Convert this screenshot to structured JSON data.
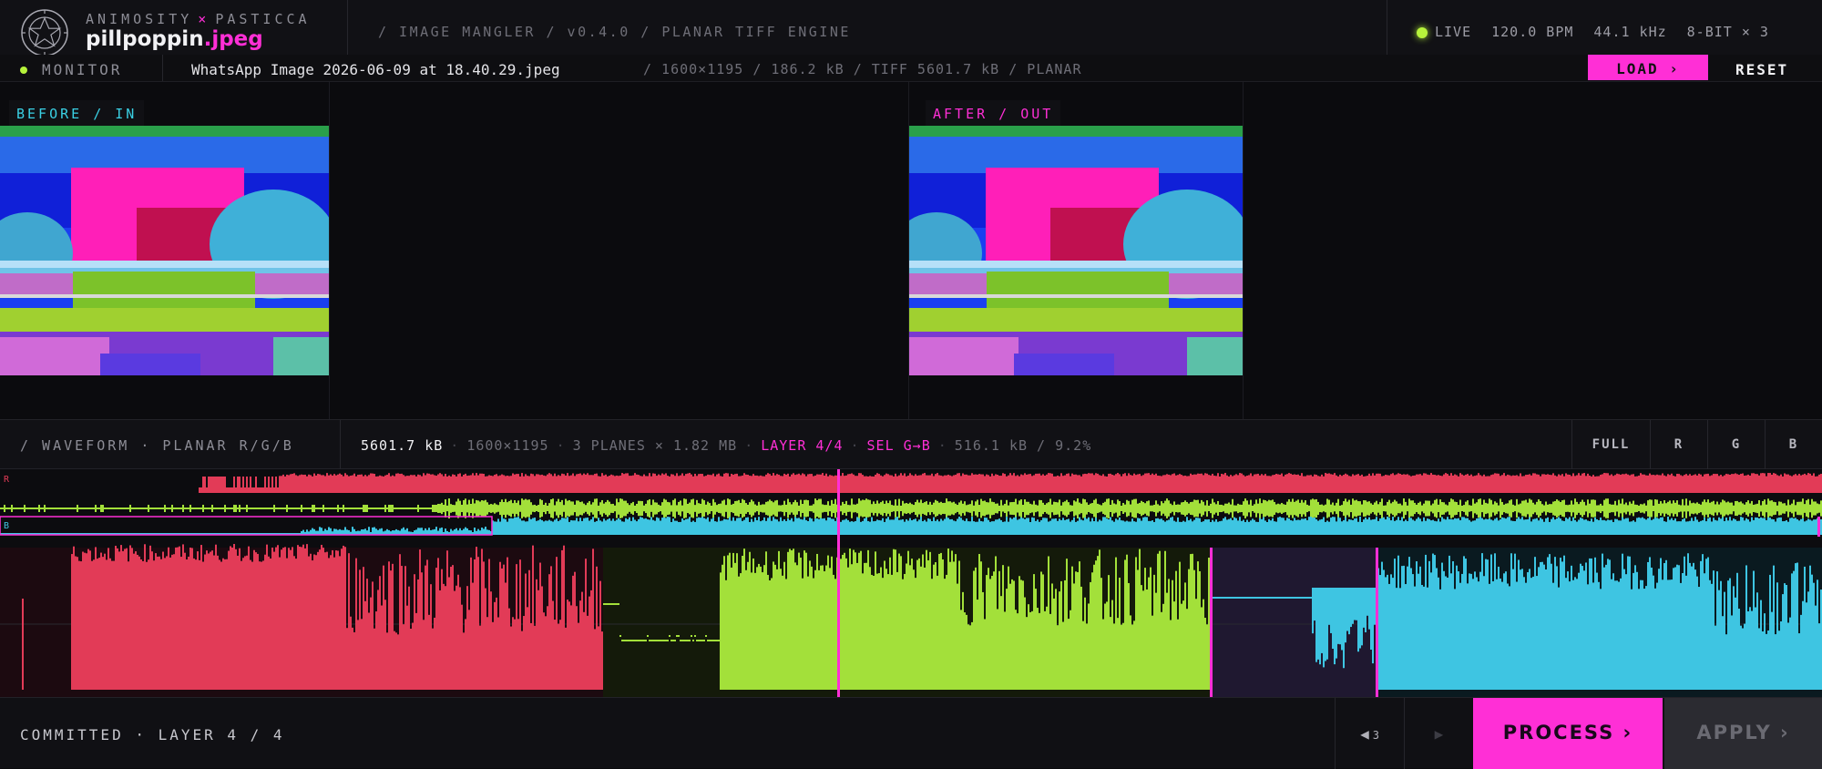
{
  "header": {
    "brand_sub_left": "ANIMOSITY",
    "brand_sub_x": "×",
    "brand_sub_right": "PASTICCA",
    "title_name": "pillpoppin",
    "title_ext": ".jpeg",
    "breadcrumb": "/ IMAGE MANGLER / v0.4.0 / PLANAR TIFF ENGINE",
    "live": "LIVE",
    "bpm": "120.0 BPM",
    "rate": "44.1 kHz",
    "depth": "8-BIT × 3"
  },
  "filestrip": {
    "monitor": "MONITOR",
    "filename": "WhatsApp Image 2026-06-09 at 18.40.29.jpeg",
    "meta": "/ 1600×1195 / 186.2 kB / TIFF 5601.7 kB / PLANAR",
    "load": "LOAD ›",
    "reset": "RESET"
  },
  "monitor": {
    "before_label": "BEFORE / IN",
    "after_label": "AFTER / OUT"
  },
  "waveform": {
    "title": "/ WAVEFORM · PLANAR R/G/B",
    "size": "5601.7 kB",
    "dims": "1600×1195",
    "planes": "3 PLANES × 1.82 MB",
    "layer": "LAYER 4/4",
    "selection": "SEL G→B",
    "sel_size": "516.1 kB / 9.2%",
    "btn_full": "FULL",
    "btn_r": "R",
    "btn_g": "G",
    "btn_b": "B",
    "lane_r": "R",
    "lane_b": "B"
  },
  "footer": {
    "status": "COMMITTED · LAYER 4 / 4",
    "prev": "◀",
    "prev_count": "3",
    "play": "▶",
    "process": "PROCESS ›",
    "apply": "APPLY ›"
  },
  "colors": {
    "accent": "#ff2fd6",
    "live": "#b6f23b",
    "red": "#e23b57",
    "green": "#a3e03a",
    "blue": "#3ec5e2"
  }
}
